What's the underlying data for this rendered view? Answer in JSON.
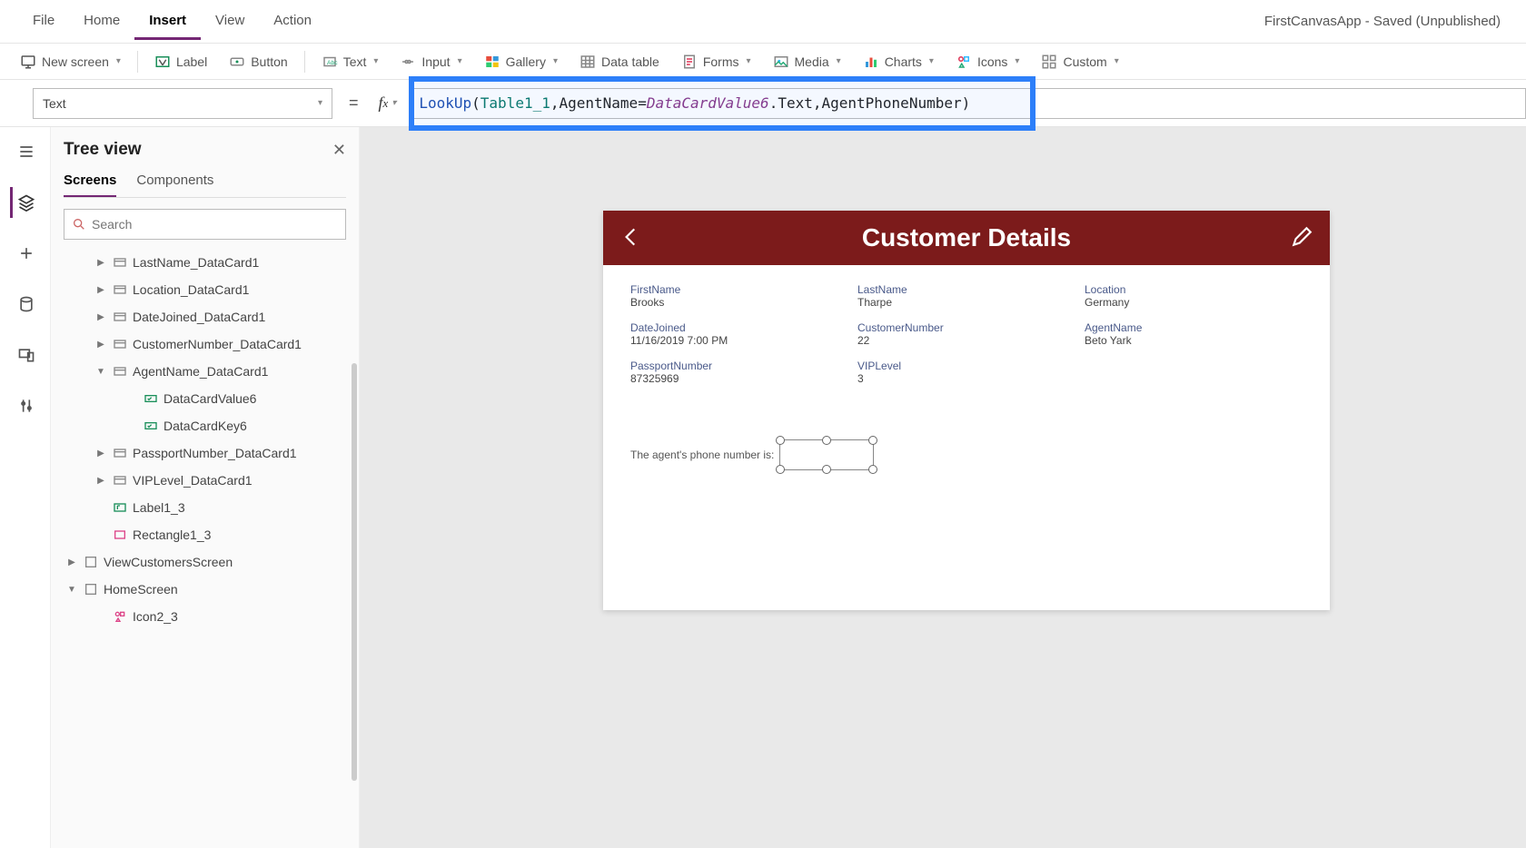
{
  "app_status": "FirstCanvasApp - Saved (Unpublished)",
  "menubar": [
    "File",
    "Home",
    "Insert",
    "View",
    "Action"
  ],
  "menubar_active": "Insert",
  "ribbon": {
    "new_screen": "New screen",
    "label": "Label",
    "button": "Button",
    "text": "Text",
    "input": "Input",
    "gallery": "Gallery",
    "data_table": "Data table",
    "forms": "Forms",
    "media": "Media",
    "charts": "Charts",
    "icons": "Icons",
    "custom": "Custom"
  },
  "property_selector": "Text",
  "formula": {
    "fn": "LookUp",
    "table": "Table1_1",
    "field": "AgentName",
    "obj": "DataCardValue6",
    "member": ".Text, ",
    "ret": "AgentPhoneNumber"
  },
  "tree": {
    "title": "Tree view",
    "tabs": [
      "Screens",
      "Components"
    ],
    "active_tab": "Screens",
    "search_placeholder": "Search",
    "items": [
      {
        "label": "LastName_DataCard1",
        "indent": 1,
        "twisty": ">",
        "icon": "card"
      },
      {
        "label": "Location_DataCard1",
        "indent": 1,
        "twisty": ">",
        "icon": "card"
      },
      {
        "label": "DateJoined_DataCard1",
        "indent": 1,
        "twisty": ">",
        "icon": "card"
      },
      {
        "label": "CustomerNumber_DataCard1",
        "indent": 1,
        "twisty": ">",
        "icon": "card"
      },
      {
        "label": "AgentName_DataCard1",
        "indent": 1,
        "twisty": "v",
        "icon": "card"
      },
      {
        "label": "DataCardValue6",
        "indent": 2,
        "twisty": "",
        "icon": "input"
      },
      {
        "label": "DataCardKey6",
        "indent": 2,
        "twisty": "",
        "icon": "input"
      },
      {
        "label": "PassportNumber_DataCard1",
        "indent": 1,
        "twisty": ">",
        "icon": "card"
      },
      {
        "label": "VIPLevel_DataCard1",
        "indent": 1,
        "twisty": ">",
        "icon": "card"
      },
      {
        "label": "Label1_3",
        "indent": 1,
        "twisty": "",
        "icon": "label"
      },
      {
        "label": "Rectangle1_3",
        "indent": 1,
        "twisty": "",
        "icon": "rect"
      },
      {
        "label": "ViewCustomersScreen",
        "indent": 0,
        "twisty": ">",
        "icon": "screen"
      },
      {
        "label": "HomeScreen",
        "indent": 0,
        "twisty": "v",
        "icon": "screen"
      },
      {
        "label": "Icon2_3",
        "indent": 1,
        "twisty": "",
        "icon": "icons"
      }
    ]
  },
  "preview": {
    "title": "Customer Details",
    "fields": [
      {
        "label": "FirstName",
        "value": "Brooks"
      },
      {
        "label": "LastName",
        "value": "Tharpe"
      },
      {
        "label": "Location",
        "value": "Germany"
      },
      {
        "label": "DateJoined",
        "value": "11/16/2019 7:00 PM"
      },
      {
        "label": "CustomerNumber",
        "value": "22"
      },
      {
        "label": "AgentName",
        "value": "Beto Yark"
      },
      {
        "label": "PassportNumber",
        "value": "87325969"
      },
      {
        "label": "VIPLevel",
        "value": "3"
      }
    ],
    "agent_label": "The agent's phone number is:"
  }
}
